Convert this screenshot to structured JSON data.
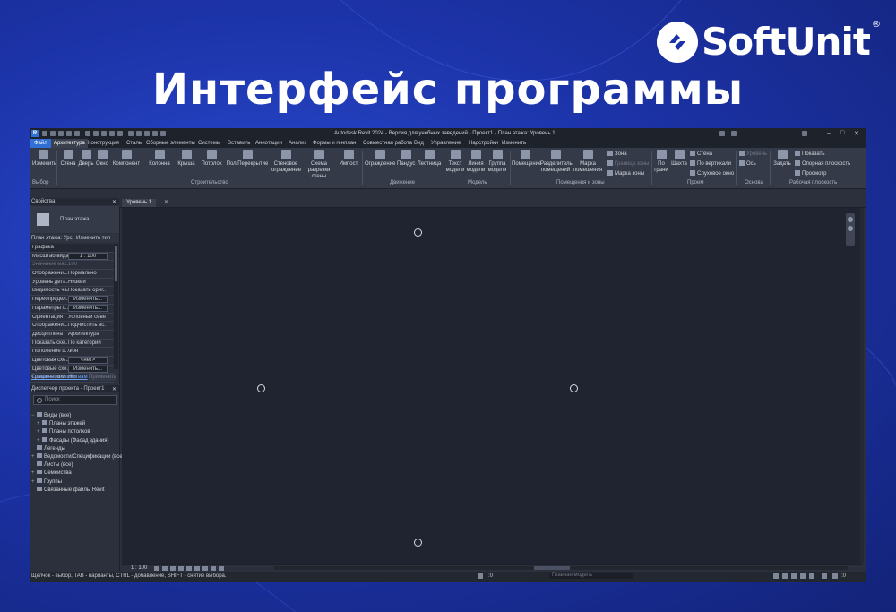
{
  "slide": {
    "brand": "SoftUnit",
    "registered": "®",
    "headline": "Интерфейс программы"
  },
  "window": {
    "app_logo": "R",
    "title": "Autodesk Revit 2024 - Версия для учебных заведений - Проект1 - План этажа: Уровень 1",
    "min": "–",
    "max": "□",
    "close": "✕"
  },
  "menu": {
    "file": "Файл",
    "tabs": [
      "Архитектура",
      "Конструкция",
      "Сталь",
      "Сборные элементы",
      "Системы",
      "Вставить",
      "Аннотации",
      "Анализ",
      "Формы и генплан",
      "Совместная работа",
      "Вид",
      "Управление",
      "Надстройки",
      "Изменить"
    ],
    "active_tab": "Архитектура"
  },
  "ribbon": {
    "tools": [
      {
        "label": "Изменить"
      },
      {
        "label": "Стена"
      },
      {
        "label": "Дверь"
      },
      {
        "label": "Окно"
      },
      {
        "label": "Компонент"
      },
      {
        "label": "Колонна"
      },
      {
        "label": "Крыша"
      },
      {
        "label": "Потолок"
      },
      {
        "label": "Пол/Перекрытие"
      },
      {
        "label": "Стеновое ограждение"
      },
      {
        "label": "Схема разрезки стены"
      },
      {
        "label": "Импост"
      },
      {
        "label": "Ограждение"
      },
      {
        "label": "Пандус"
      },
      {
        "label": "Лестница"
      },
      {
        "label": "Текст модели"
      },
      {
        "label": "Линия модели"
      },
      {
        "label": "Группа модели"
      },
      {
        "label": "Помещение"
      },
      {
        "label": "Разделитель помещений"
      },
      {
        "label": "Марка помещения"
      },
      {
        "label": "По грани"
      },
      {
        "label": "Шахта"
      },
      {
        "label": "Задать"
      }
    ],
    "small_tools": {
      "zone": "Зона",
      "zone_boundary": "Граница зоны",
      "zone_tag": "Марка зоны",
      "wall": "Стена",
      "vertical": "По вертикали",
      "dormer": "Слуховое окно",
      "level": "Уровень",
      "grid": "Ось",
      "show": "Показать",
      "ref_plane": "Опорная плоскость",
      "viewer": "Просмотр"
    },
    "groups": [
      "Выбор",
      "Строительство",
      "Движение",
      "Модель",
      "Помещения и зоны",
      "Проем",
      "Основа",
      "Рабочая плоскость"
    ]
  },
  "properties": {
    "title": "Свойства",
    "close": "✕",
    "type_name": "План этажа",
    "filter_label": "План этажа: Урс",
    "edit_type": "Изменить тип",
    "rows": [
      {
        "k": "Графика",
        "v": "",
        "section": true
      },
      {
        "k": "Масштаб вида",
        "v": "1 : 100",
        "box": true
      },
      {
        "k": "Значение мас...",
        "v": "100",
        "dim": true
      },
      {
        "k": "Отображени...",
        "v": "Нормально"
      },
      {
        "k": "Уровень дета...",
        "v": "Низкий"
      },
      {
        "k": "Видимость ча...",
        "v": "Показать ориг..."
      },
      {
        "k": "Переопредел...",
        "v": "Изменить...",
        "box": true
      },
      {
        "k": "Параметры о...",
        "v": "Изменить...",
        "box": true
      },
      {
        "k": "Ориентация",
        "v": "Условный север"
      },
      {
        "k": "Отображени...",
        "v": "Подчистить вс..."
      },
      {
        "k": "Дисциплина",
        "v": "Архитектура"
      },
      {
        "k": "Показать ске...",
        "v": "По категории"
      },
      {
        "k": "Положение ц...",
        "v": "Фон"
      },
      {
        "k": "Цветовая схе...",
        "v": "<нет>",
        "box": true
      },
      {
        "k": "Цветовые схе...",
        "v": "Изменить...",
        "box": true
      },
      {
        "k": "Графический ...",
        "v": "Нет"
      }
    ],
    "help_link": "Справка по свойствам",
    "apply": "Применить"
  },
  "browser": {
    "title": "Диспетчер проекта - Проект1",
    "close": "✕",
    "search_placeholder": "Поиск",
    "items": [
      {
        "label": "Виды (все)",
        "toggle": "−",
        "level": 0
      },
      {
        "label": "Планы этажей",
        "toggle": "+",
        "level": 1
      },
      {
        "label": "Планы потолков",
        "toggle": "+",
        "level": 1
      },
      {
        "label": "Фасады (Фасад здания)",
        "toggle": "+",
        "level": 1
      },
      {
        "label": "Легенды",
        "toggle": "",
        "level": 0
      },
      {
        "label": "Ведомости/Спецификации (все)",
        "toggle": "+",
        "level": 0
      },
      {
        "label": "Листы (все)",
        "toggle": "",
        "level": 0
      },
      {
        "label": "Семейства",
        "toggle": "+",
        "level": 0
      },
      {
        "label": "Группы",
        "toggle": "+",
        "level": 0
      },
      {
        "label": "Связанные файлы Revit",
        "toggle": "",
        "level": 0
      }
    ]
  },
  "view": {
    "tab_label": "Уровень 1",
    "tab_close": "✕",
    "scale": "1 : 100"
  },
  "status": {
    "hint": "Щелчок - выбор, TAB - варианты, CTRL - добавление, SHIFT - снятие выбора.",
    "workset": ":0",
    "model": "Главная модель",
    "filter": ":0"
  }
}
